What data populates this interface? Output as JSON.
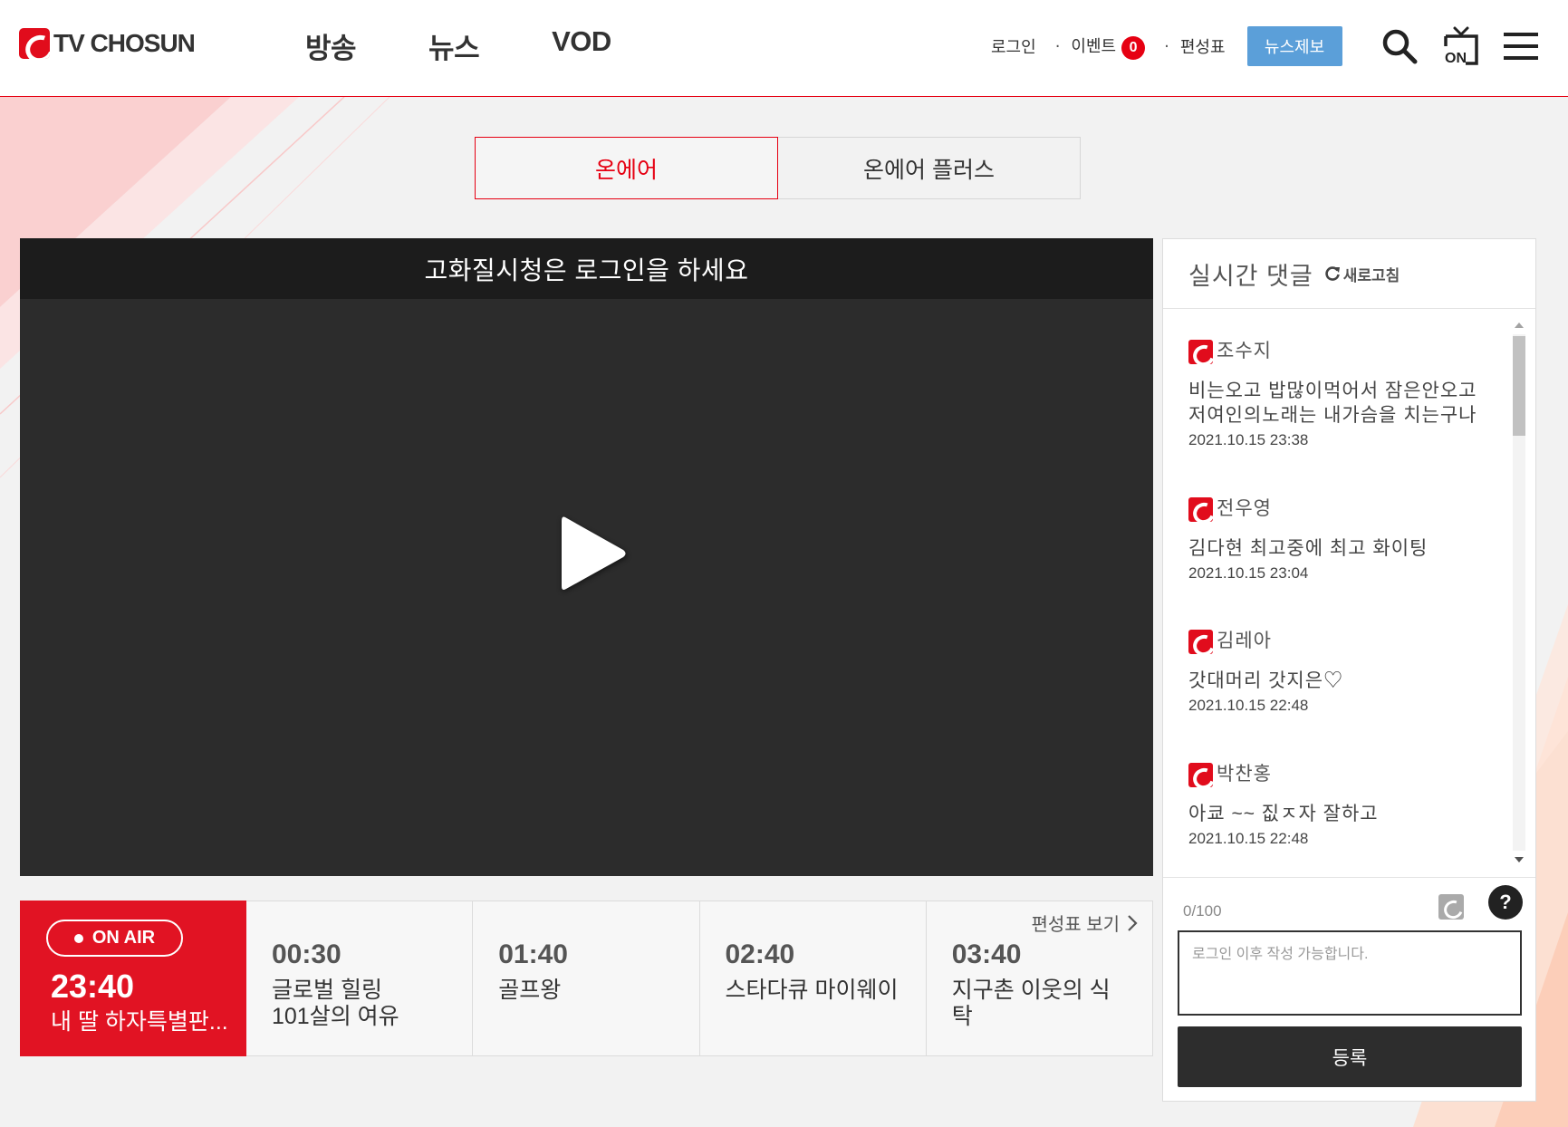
{
  "brand": {
    "logo_text": "TV CHOSUN",
    "accent": "#e60012"
  },
  "nav": {
    "items": [
      {
        "label": "방송"
      },
      {
        "label": "뉴스"
      },
      {
        "label": "VOD"
      }
    ]
  },
  "util": {
    "login": "로그인",
    "event": "이벤트",
    "event_count": "0",
    "schedule": "편성표",
    "news_tip": "뉴스제보",
    "icons": [
      "search-icon",
      "on-air-tv-icon",
      "hamburger-menu-icon"
    ]
  },
  "tabs": [
    {
      "label": "온에어",
      "active": true
    },
    {
      "label": "온에어 플러스",
      "active": false
    }
  ],
  "player": {
    "notice": "고화질시청은 로그인을 하세요",
    "icon": "play-icon"
  },
  "schedule": {
    "now": {
      "badge": "ON AIR",
      "time": "23:40",
      "title": "내 딸 하자특별판..."
    },
    "upcoming": [
      {
        "time": "00:30",
        "title": "글로벌 힐링\n101살의 여유"
      },
      {
        "time": "01:40",
        "title": "골프왕"
      },
      {
        "time": "02:40",
        "title": "스타다큐 마이웨이"
      },
      {
        "time": "03:40",
        "title": "지구촌 이웃의 식탁"
      }
    ],
    "view_link": "편성표 보기"
  },
  "chat": {
    "title": "실시간 댓글",
    "refresh": "새로고침",
    "comments": [
      {
        "user": "조수지",
        "text": "비는오고 밥많이먹어서 잠은안오고 저여인의노래는 내가슴을 치는구나",
        "time": "2021.10.15 23:38"
      },
      {
        "user": "전우영",
        "text": "김다현 최고중에 최고 화이팅",
        "time": "2021.10.15 23:04"
      },
      {
        "user": "김레아",
        "text": "갓대머리 갓지은♡",
        "time": "2021.10.15 22:48"
      },
      {
        "user": "박찬홍",
        "text": "아쿄 ~~ 짒ㅈ자 잘하고",
        "time": "2021.10.15 22:48"
      }
    ],
    "char_count": "0/100",
    "placeholder": "로그인 이후 작성 가능합니다.",
    "help": "?",
    "submit": "등록"
  }
}
